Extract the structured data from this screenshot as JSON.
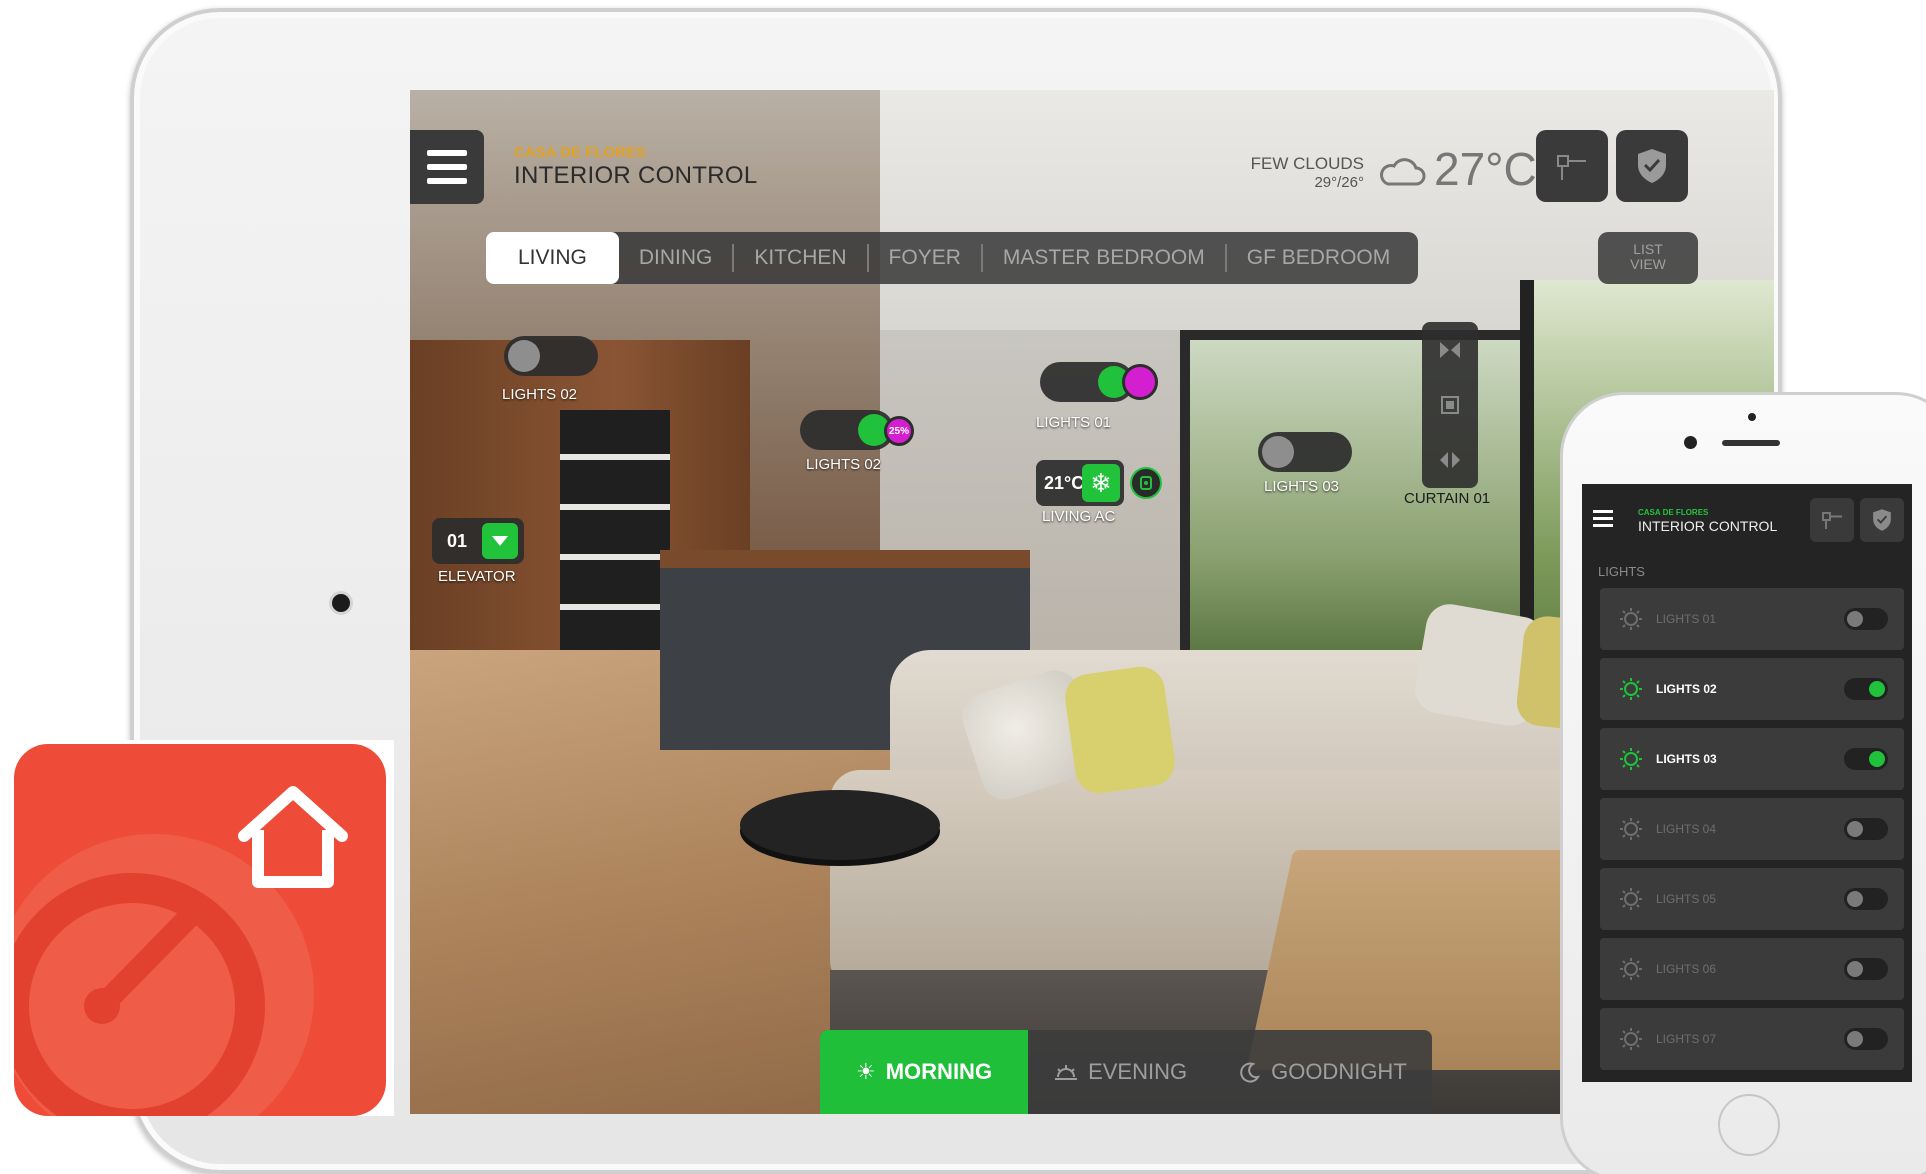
{
  "brand": {
    "subtitle": "CASA DE FLORES",
    "title": "INTERIOR CONTROL"
  },
  "weather": {
    "condition": "FEW CLOUDS",
    "range": "29°/26°",
    "temp": "27°C",
    "icon": "cloud-icon"
  },
  "header_buttons": [
    {
      "icon": "key-icon"
    },
    {
      "icon": "shield-icon"
    }
  ],
  "tabs": [
    "LIVING",
    "DINING",
    "KITCHEN",
    "FOYER",
    "MASTER BEDROOM",
    "GF BEDROOM"
  ],
  "active_tab": "LIVING",
  "list_view": {
    "line1": "LIST",
    "line2": "VIEW"
  },
  "curtain": {
    "label": "CURTAIN 01",
    "icons": [
      "curtain-close-icon",
      "curtain-stop-icon",
      "curtain-open-icon"
    ]
  },
  "devices": {
    "lights02_left": {
      "label": "LIGHTS 02",
      "state": "off"
    },
    "lights02_mid": {
      "label": "LIGHTS 02",
      "state": "on",
      "dim": "25%"
    },
    "lights01": {
      "label": "LIGHTS 01",
      "state": "on"
    },
    "lights03": {
      "label": "LIGHTS 03",
      "state": "off"
    },
    "living_ac": {
      "label": "LIVING AC",
      "temp": "21°C",
      "mode_icon": "snowflake-icon"
    },
    "elevator": {
      "label": "ELEVATOR",
      "floor": "01"
    }
  },
  "scenes": [
    {
      "label": "MORNING",
      "icon": "sun-icon",
      "active": true
    },
    {
      "label": "EVENING",
      "icon": "sunset-icon",
      "active": false
    },
    {
      "label": "GOODNIGHT",
      "icon": "moon-icon",
      "active": false
    }
  ],
  "app_icon": {
    "icon": "home-icon"
  },
  "phone": {
    "subtitle": "CASA DE FLORES",
    "title": "INTERIOR CONTROL",
    "section": "LIGHTS",
    "lights": [
      {
        "label": "LIGHTS 01",
        "on": false
      },
      {
        "label": "LIGHTS 02",
        "on": true
      },
      {
        "label": "LIGHTS 03",
        "on": true
      },
      {
        "label": "LIGHTS 04",
        "on": false
      },
      {
        "label": "LIGHTS 05",
        "on": false
      },
      {
        "label": "LIGHTS 06",
        "on": false
      },
      {
        "label": "LIGHTS 07",
        "on": false
      }
    ]
  },
  "colors": {
    "accent_green": "#1fc23a",
    "brand_orange": "#e2a11f",
    "dim_magenta": "#d41fd1",
    "app_red": "#ee4c38"
  }
}
